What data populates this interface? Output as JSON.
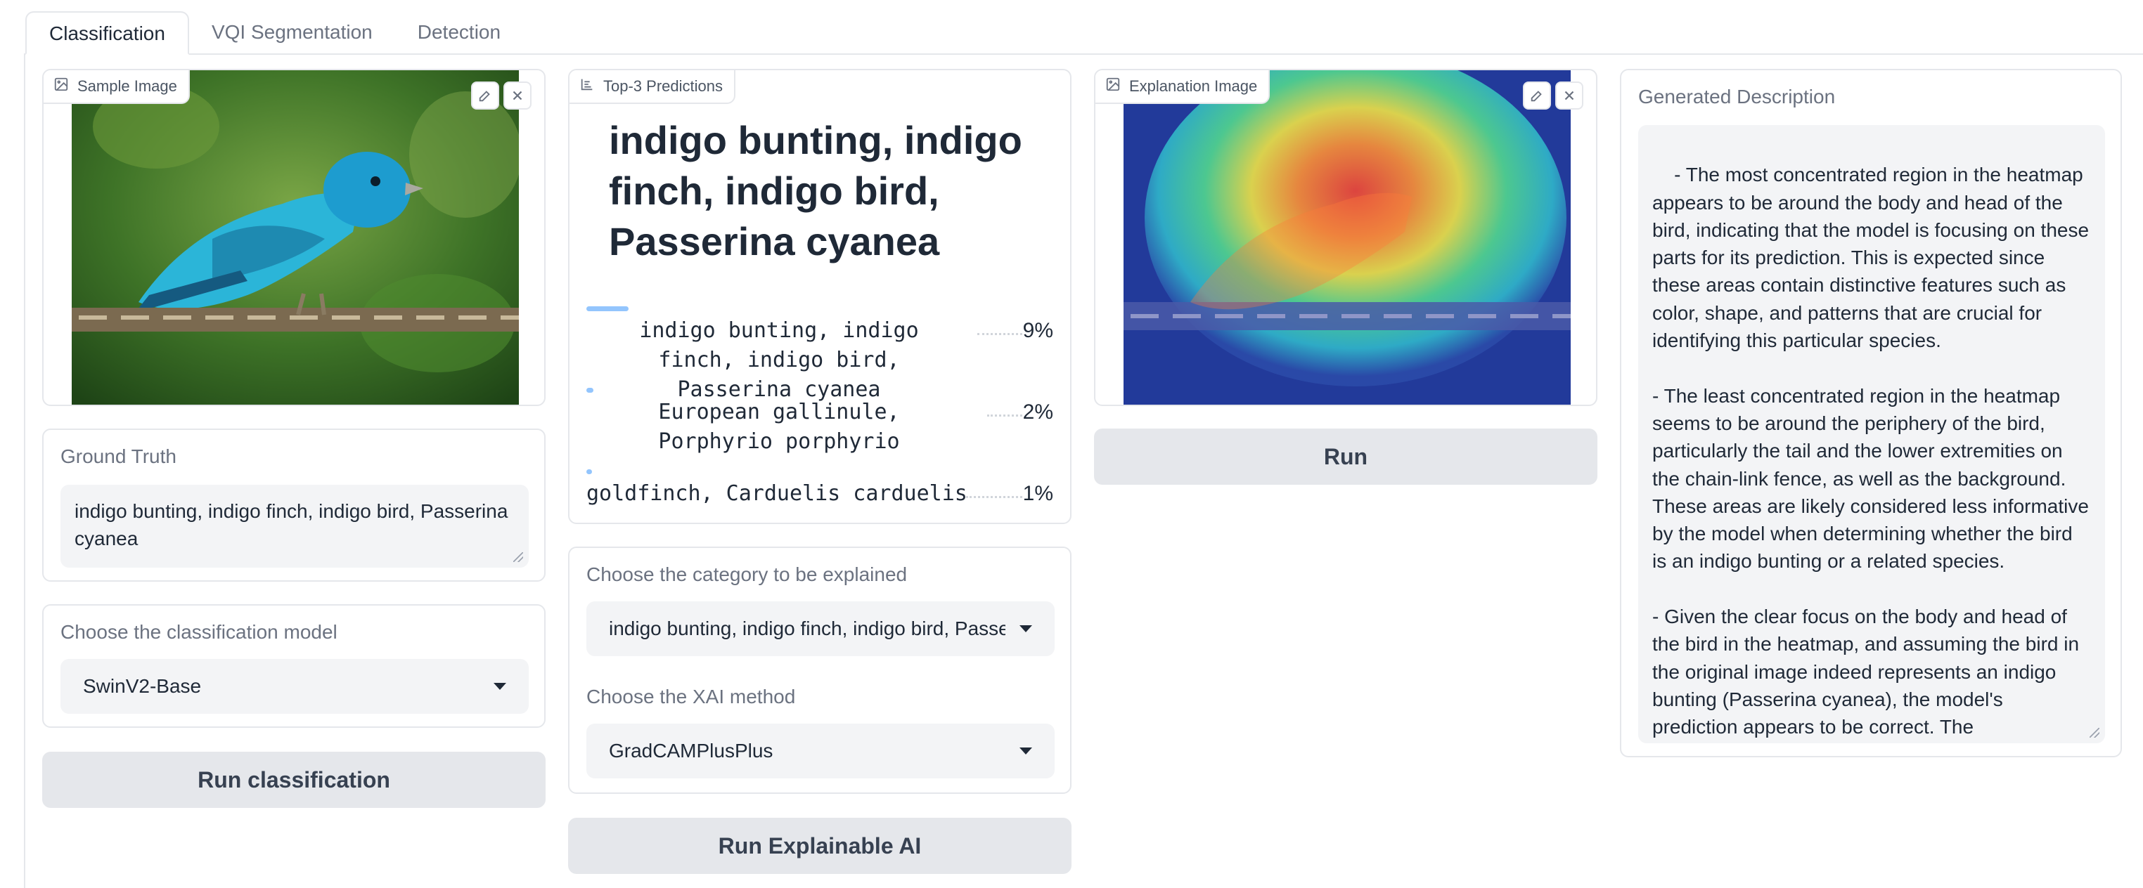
{
  "tabs": [
    {
      "label": "Classification",
      "active": true
    },
    {
      "label": "VQI Segmentation",
      "active": false
    },
    {
      "label": "Detection",
      "active": false
    }
  ],
  "sample_image": {
    "label": "Sample Image",
    "icon": "image-icon"
  },
  "ground_truth": {
    "label": "Ground Truth",
    "value": "indigo bunting, indigo finch, indigo bird, Passerina cyanea"
  },
  "classification_model": {
    "label": "Choose the classification model",
    "value": "SwinV2-Base"
  },
  "run_classification": {
    "label": "Run classification"
  },
  "predictions": {
    "badge": "Top-3 Predictions",
    "top_label": "indigo bunting, indigo finch, indigo bird, Passerina cyanea",
    "items": [
      {
        "label": "indigo bunting, indigo finch, indigo bird, Passerina cyanea",
        "percent": "9%",
        "fraction": 0.09
      },
      {
        "label": "European gallinule, Porphyrio porphyrio",
        "percent": "2%",
        "fraction": 0.02
      },
      {
        "label": "goldfinch, Carduelis carduelis",
        "percent": "1%",
        "fraction": 0.01
      }
    ]
  },
  "category": {
    "label": "Choose the category to be explained",
    "value": "indigo bunting, indigo finch, indigo bird, Passerina cyanea"
  },
  "xai_method": {
    "label": "Choose the XAI method",
    "value": "GradCAMPlusPlus"
  },
  "run_xai": {
    "label": "Run Explainable AI"
  },
  "explanation_image": {
    "label": "Explanation Image"
  },
  "run": {
    "label": "Run"
  },
  "description": {
    "label": "Generated Description",
    "text": "- The most concentrated region in the heatmap appears to be around the body and head of the bird, indicating that the model is focusing on these parts for its prediction. This is expected since these areas contain distinctive features such as color, shape, and patterns that are crucial for identifying this particular species.\n\n- The least concentrated region in the heatmap seems to be around the periphery of the bird, particularly the tail and the lower extremities on the chain-link fence, as well as the background. These areas are likely considered less informative by the model when determining whether the bird is an indigo bunting or a related species.\n\n- Given the clear focus on the body and head of the bird in the heatmap, and assuming the bird in the original image indeed represents an indigo bunting (Passerina cyanea), the model's prediction appears to be correct. The concentrated region is supportive for the model to correctly identify the bird, as it aligns"
  },
  "colors": {
    "bar": "#93c5fd",
    "button_bg": "#e5e7eb",
    "field_bg": "#f3f4f6",
    "bird_blue": "#2bb5d8"
  }
}
